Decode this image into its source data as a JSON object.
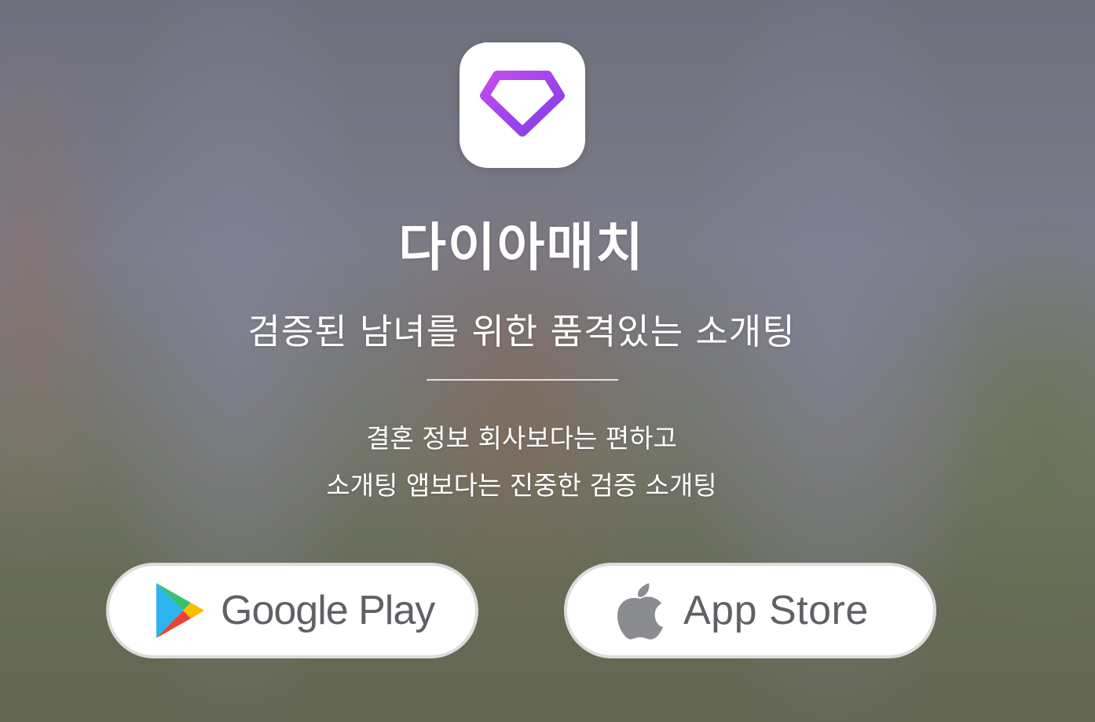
{
  "app": {
    "name": "다이아매치",
    "tagline": "검증된 남녀를 위한 품격있는 소개팅",
    "description_lines": [
      "결혼 정보 회사보다는 편하고",
      "소개팅 앱보다는 진중한 검증 소개팅"
    ],
    "icon": "diamond-heart-icon"
  },
  "stores": {
    "google": {
      "label": "Google Play",
      "icon": "google-play-icon"
    },
    "apple": {
      "label": "App Store",
      "icon": "apple-icon"
    }
  },
  "colors": {
    "brand_gradient_start": "#b14af2",
    "brand_gradient_end": "#8a3fe6",
    "text": "#ffffff",
    "store_label": "#5f6166"
  }
}
